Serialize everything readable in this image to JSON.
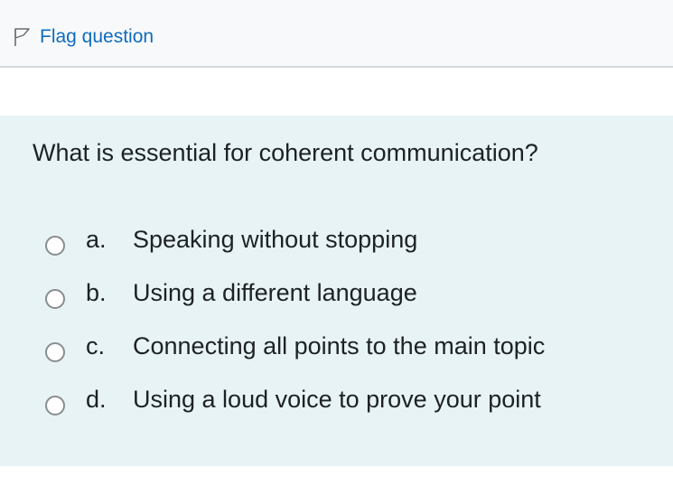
{
  "info": {
    "flag_label": "Flag question"
  },
  "question": {
    "text": "What is essential for coherent communication?",
    "answers": [
      {
        "letter": "a.",
        "text": "Speaking without stopping"
      },
      {
        "letter": "b.",
        "text": "Using a different language"
      },
      {
        "letter": "c.",
        "text": "Connecting all points to the main topic"
      },
      {
        "letter": "d.",
        "text": "Using a loud voice to prove your point"
      }
    ]
  },
  "colors": {
    "link": "#0f6cbf",
    "question_background": "#e7f3f5",
    "text": "#1d2125"
  }
}
